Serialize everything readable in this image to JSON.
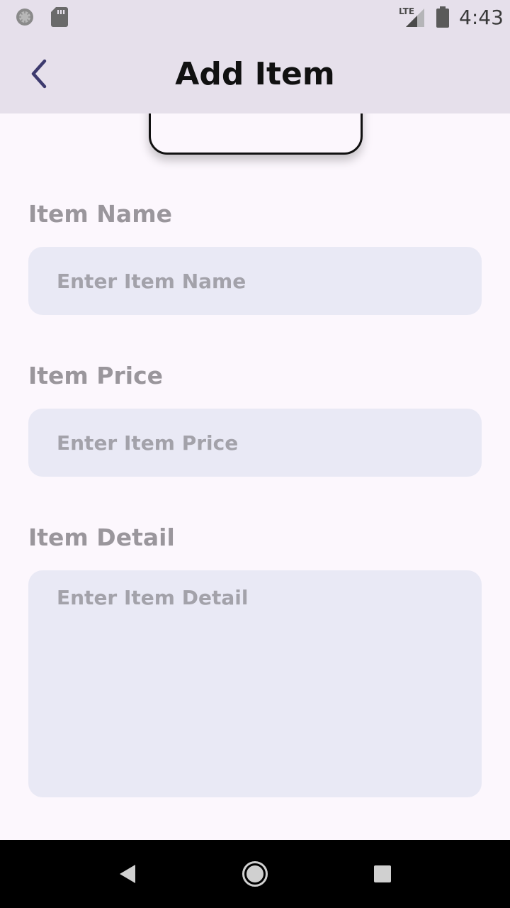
{
  "status_bar": {
    "time": "4:43",
    "network": "LTE",
    "icons": [
      "sync-icon",
      "sd-card-icon",
      "lte-signal-icon",
      "battery-icon"
    ]
  },
  "app_bar": {
    "title": "Add Item",
    "back_icon": "chevron-left-icon"
  },
  "form": {
    "name": {
      "label": "Item Name",
      "placeholder": "Enter Item Name",
      "value": ""
    },
    "price": {
      "label": "Item Price",
      "placeholder": "Enter Item Price",
      "value": ""
    },
    "detail": {
      "label": "Item Detail",
      "placeholder": "Enter Item Detail",
      "value": ""
    }
  },
  "nav_bar": {
    "icons": [
      "back-triangle-icon",
      "home-circle-icon",
      "recents-square-icon"
    ]
  },
  "colors": {
    "app_bar_bg": "#e6e0eb",
    "page_bg": "#fcf7fd",
    "input_bg": "#e9e9f5",
    "label_color": "#9a969c",
    "back_icon_color": "#3d3a6e"
  }
}
